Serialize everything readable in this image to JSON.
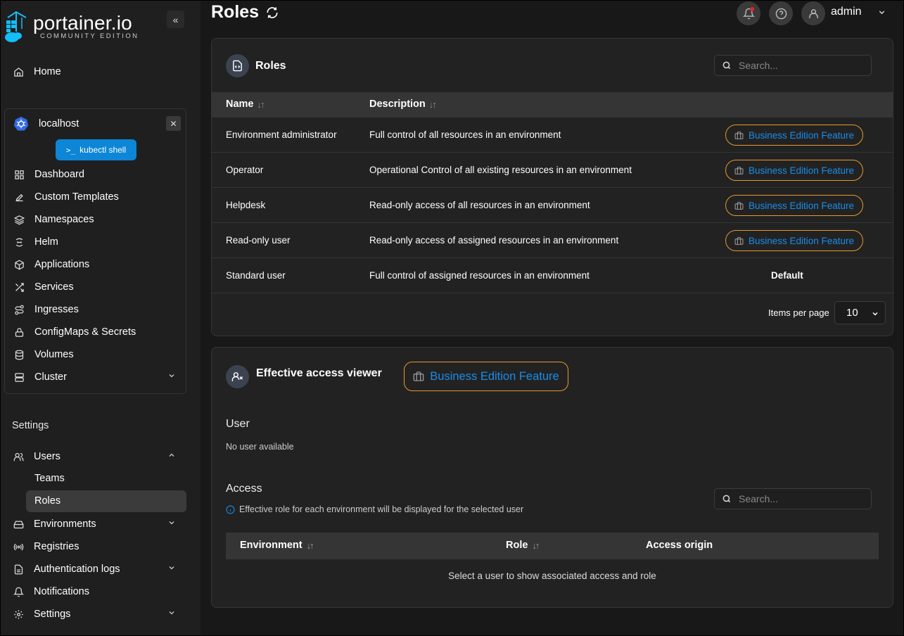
{
  "brand": {
    "name": "portainer.io",
    "edition": "COMMUNITY EDITION"
  },
  "sidebar": {
    "collapse_icon": "«",
    "home": "Home",
    "environment": {
      "name": "localhost",
      "close_icon": "✕",
      "kubectl_label": "kubectl shell",
      "items": [
        "Dashboard",
        "Custom Templates",
        "Namespaces",
        "Helm",
        "Applications",
        "Services",
        "Ingresses",
        "ConfigMaps & Secrets",
        "Volumes",
        "Cluster"
      ]
    },
    "settings_heading": "Settings",
    "settings_items": {
      "users": "Users",
      "teams": "Teams",
      "roles": "Roles",
      "environments": "Environments",
      "registries": "Registries",
      "auth_logs": "Authentication logs",
      "notifications": "Notifications",
      "settings": "Settings"
    }
  },
  "header": {
    "title": "Roles",
    "user": "admin"
  },
  "roles_card": {
    "title": "Roles",
    "search_placeholder": "Search...",
    "columns": {
      "name": "Name",
      "description": "Description"
    },
    "sort_glyph": "↓↑",
    "rows": [
      {
        "name": "Environment administrator",
        "description": "Full control of all resources in an environment",
        "badge": "Business Edition Feature"
      },
      {
        "name": "Operator",
        "description": "Operational Control of all existing resources in an environment",
        "badge": "Business Edition Feature"
      },
      {
        "name": "Helpdesk",
        "description": "Read-only access of all resources in an environment",
        "badge": "Business Edition Feature"
      },
      {
        "name": "Read-only user",
        "description": "Read-only access of assigned resources in an environment",
        "badge": "Business Edition Feature"
      },
      {
        "name": "Standard user",
        "description": "Full control of assigned resources in an environment",
        "default_label": "Default"
      }
    ],
    "items_per_page_label": "Items per page",
    "items_per_page_value": "10"
  },
  "access_card": {
    "title": "Effective access viewer",
    "badge": "Business Edition Feature",
    "user_label": "User",
    "no_user": "No user available",
    "access_label": "Access",
    "info_text": "Effective role for each environment will be displayed for the selected user",
    "search_placeholder": "Search...",
    "columns": {
      "environment": "Environment",
      "role": "Role",
      "access_origin": "Access origin"
    },
    "empty_message": "Select a user to show associated access and role"
  },
  "colors": {
    "accent": "#0d86d7",
    "badge_border": "#e69a2e",
    "badge_text": "#1a8dea",
    "notif": "#e32323"
  }
}
